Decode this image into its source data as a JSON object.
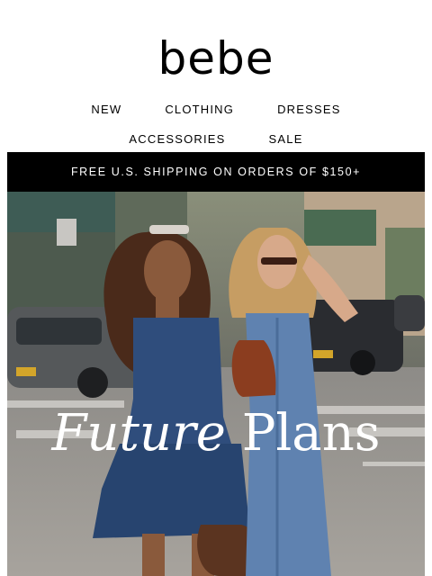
{
  "brand": {
    "logo_text": "bebe"
  },
  "nav": {
    "row1": [
      "NEW",
      "CLOTHING",
      "DRESSES"
    ],
    "row2": [
      "ACCESSORIES",
      "SALE"
    ]
  },
  "banner": {
    "text": "FREE U.S. SHIPPING ON ORDERS OF $150+"
  },
  "hero": {
    "headline_part1": "Future",
    "headline_part2": "Plans",
    "image_subject": "two-women-in-denim-crossing-street"
  },
  "colors": {
    "banner_bg": "#000000",
    "denim": "#3d5f8f",
    "text": "#000000"
  }
}
